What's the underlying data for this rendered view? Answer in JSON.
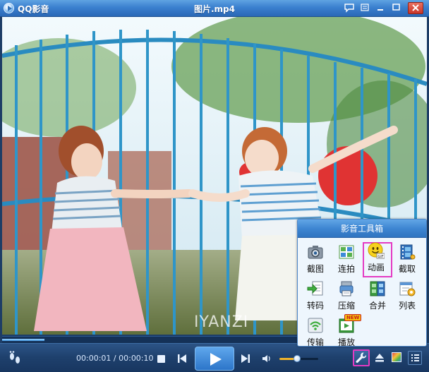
{
  "window": {
    "app_name": "QQ影音",
    "title": "图片.mp4"
  },
  "video": {
    "watermark": "IYANZI"
  },
  "seek": {
    "progress": 0.1
  },
  "controls": {
    "current_time": "00:00:01",
    "separator": " / ",
    "total_time": "00:00:10",
    "volume_level": 0.45
  },
  "toolbox": {
    "title": "影音工具箱",
    "tools": [
      {
        "label": "截图",
        "icon": "camera-icon"
      },
      {
        "label": "连拍",
        "icon": "burst-shot-icon"
      },
      {
        "label": "动画",
        "icon": "gif-smiley-icon",
        "highlighted": true
      },
      {
        "label": "截取",
        "icon": "film-cut-icon"
      },
      {
        "label": "转码",
        "icon": "convert-icon"
      },
      {
        "label": "压缩",
        "icon": "compress-icon"
      },
      {
        "label": "合并",
        "icon": "merge-icon"
      },
      {
        "label": "列表",
        "icon": "list-settings-icon"
      },
      {
        "label": "传输",
        "icon": "wifi-transfer-icon"
      },
      {
        "label": "播放",
        "icon": "play-new-icon",
        "badge": "NEW"
      }
    ]
  },
  "colors": {
    "accent_blue": "#3b80cf",
    "highlight": "#e43bc3"
  }
}
